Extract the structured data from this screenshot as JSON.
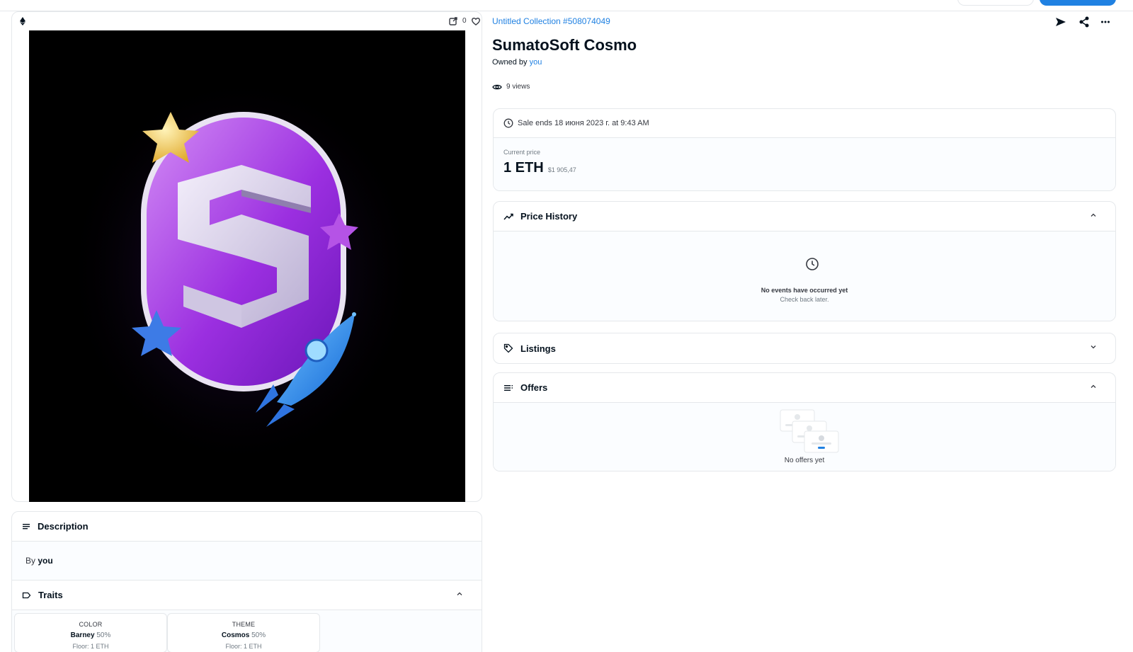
{
  "media": {
    "favorites_count": "0"
  },
  "description": {
    "title": "Description",
    "by_prefix": "By",
    "by_user": "you"
  },
  "traits": {
    "title": "Traits",
    "items": [
      {
        "type": "COLOR",
        "value": "Barney",
        "percent": "50%",
        "floor": "Floor: 1 ETH"
      },
      {
        "type": "THEME",
        "value": "Cosmos",
        "percent": "50%",
        "floor": "Floor: 1 ETH"
      }
    ]
  },
  "asset": {
    "collection": "Untitled Collection #508074049",
    "name": "SumatoSoft Cosmo",
    "owned_by_prefix": "Owned by",
    "owner": "you",
    "views": "9 views"
  },
  "sale": {
    "ends_text": "Sale ends 18 июня 2023 г. at 9:43 AM",
    "current_price_label": "Current price",
    "price_eth": "1 ETH",
    "price_usd": "$1 905,47"
  },
  "price_history": {
    "title": "Price History",
    "empty_title": "No events have occurred yet",
    "empty_sub": "Check back later."
  },
  "listings": {
    "title": "Listings"
  },
  "offers": {
    "title": "Offers",
    "empty": "No offers yet"
  },
  "colors": {
    "link_blue": "#2081e2",
    "text_primary": "#04111d",
    "border": "#e5e8eb",
    "panel_bg": "#fbfdff"
  }
}
